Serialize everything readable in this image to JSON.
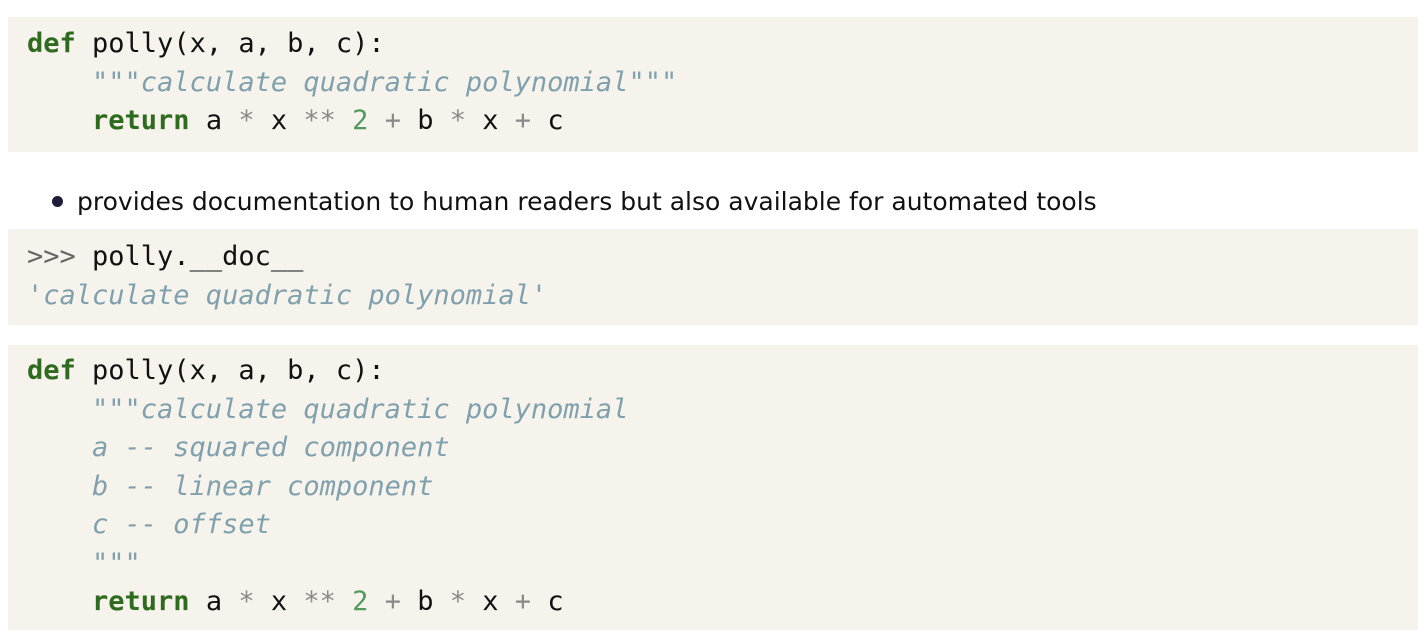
{
  "code_block_1": {
    "line1": {
      "kw": "def",
      "rest": " polly(x, a, b, c):"
    },
    "line2": {
      "doc": "\"\"\"calculate quadratic polynomial\"\"\""
    },
    "line3": {
      "kw": "return",
      "t1": " a ",
      "op1": "*",
      "t2": " x ",
      "op2": "**",
      "t3": " ",
      "num": "2",
      "t4": " ",
      "op3": "+",
      "t5": " b ",
      "op4": "*",
      "t6": " x ",
      "op5": "+",
      "t7": " c"
    }
  },
  "bullet": {
    "text": "provides documentation to human readers but also available for automated tools"
  },
  "code_block_2": {
    "line1": {
      "prompt": ">>>",
      "rest": " polly.__doc__"
    },
    "line2": {
      "output": "'calculate quadratic polynomial'"
    }
  },
  "code_block_3": {
    "line1": {
      "kw": "def",
      "rest": " polly(x, a, b, c):"
    },
    "doc_lines": [
      "\"\"\"calculate quadratic polynomial",
      "a -- squared component",
      "b -- linear component",
      "c -- offset",
      "\"\"\""
    ],
    "return_line": {
      "kw": "return",
      "t1": " a ",
      "op1": "*",
      "t2": " x ",
      "op2": "**",
      "t3": " ",
      "num": "2",
      "t4": " ",
      "op3": "+",
      "t5": " b ",
      "op4": "*",
      "t6": " x ",
      "op5": "+",
      "t7": " c"
    }
  },
  "colors": {
    "code_background": "#f6f3ec",
    "keyword": "#2f6b1e",
    "docstring": "#7fa0ac",
    "number": "#4f9a5c",
    "operator": "#8a8a8a"
  }
}
